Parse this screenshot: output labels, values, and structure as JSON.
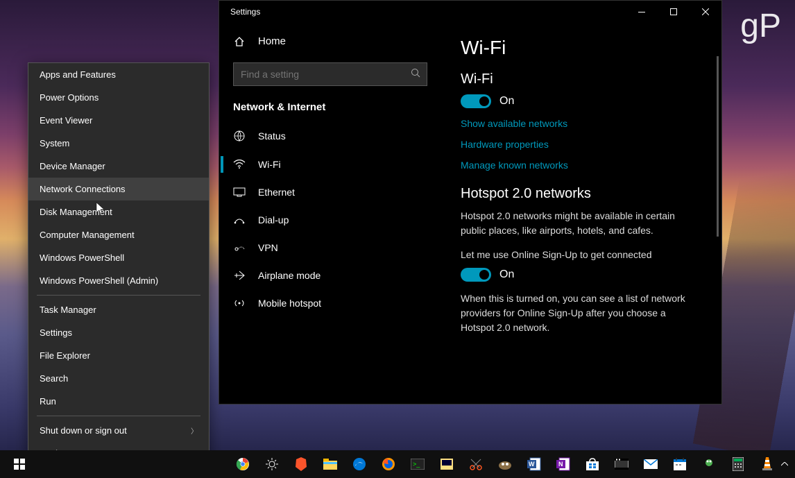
{
  "watermark": "gP",
  "context_menu": {
    "items": [
      {
        "label": "Apps and Features"
      },
      {
        "label": "Power Options"
      },
      {
        "label": "Event Viewer"
      },
      {
        "label": "System"
      },
      {
        "label": "Device Manager"
      },
      {
        "label": "Network Connections",
        "hover": true
      },
      {
        "label": "Disk Management"
      },
      {
        "label": "Computer Management"
      },
      {
        "label": "Windows PowerShell"
      },
      {
        "label": "Windows PowerShell (Admin)"
      }
    ],
    "items2": [
      {
        "label": "Task Manager"
      },
      {
        "label": "Settings"
      },
      {
        "label": "File Explorer"
      },
      {
        "label": "Search"
      },
      {
        "label": "Run"
      }
    ],
    "items3": [
      {
        "label": "Shut down or sign out",
        "submenu": true
      },
      {
        "label": "Desktop"
      }
    ]
  },
  "settings": {
    "title": "Settings",
    "home_label": "Home",
    "search_placeholder": "Find a setting",
    "category": "Network & Internet",
    "nav": [
      {
        "icon": "status",
        "label": "Status"
      },
      {
        "icon": "wifi",
        "label": "Wi-Fi",
        "selected": true
      },
      {
        "icon": "ethernet",
        "label": "Ethernet"
      },
      {
        "icon": "dialup",
        "label": "Dial-up"
      },
      {
        "icon": "vpn",
        "label": "VPN"
      },
      {
        "icon": "airplane",
        "label": "Airplane mode"
      },
      {
        "icon": "hotspot",
        "label": "Mobile hotspot"
      }
    ],
    "content": {
      "page_title": "Wi-Fi",
      "wifi_heading": "Wi-Fi",
      "wifi_toggle_state": "On",
      "link_show": "Show available networks",
      "link_hw": "Hardware properties",
      "link_manage": "Manage known networks",
      "hotspot_heading": "Hotspot 2.0 networks",
      "hotspot_desc": "Hotspot 2.0 networks might be available in certain public places, like airports, hotels, and cafes.",
      "online_signup_label": "Let me use Online Sign-Up to get connected",
      "online_signup_state": "On",
      "online_signup_desc": "When this is turned on, you can see a list of network providers for Online Sign-Up after you choose a Hotspot 2.0 network."
    }
  },
  "taskbar": {
    "apps": [
      "chrome",
      "brightness",
      "brave",
      "explorer",
      "edge",
      "firefox",
      "terminal",
      "putty",
      "snip",
      "gimp",
      "word",
      "onenote",
      "store",
      "video",
      "mail",
      "calendar",
      "spotify",
      "calc",
      "vlc"
    ]
  }
}
